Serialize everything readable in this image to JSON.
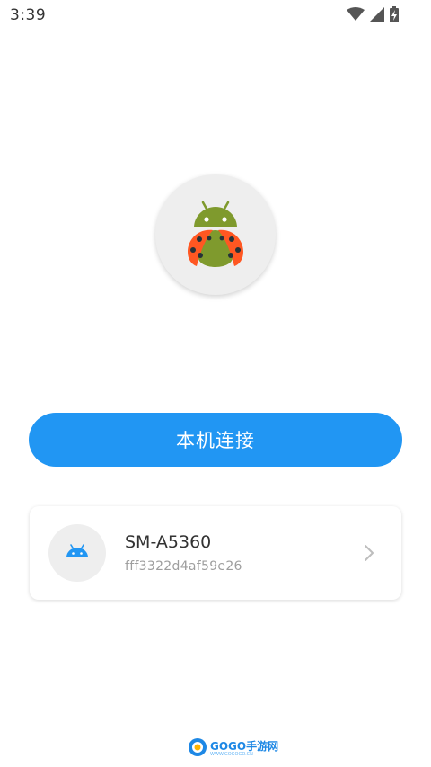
{
  "status_bar": {
    "time": "3:39",
    "icons": [
      "wifi-icon",
      "signal-icon",
      "battery-charging-icon"
    ]
  },
  "app": {
    "logo_icon": "ladybug-android-logo"
  },
  "actions": {
    "connect_local_label": "本机连接"
  },
  "devices": [
    {
      "name": "SM-A5360",
      "serial": "fff3322d4af59e26",
      "icon": "android-icon"
    }
  ],
  "watermark": {
    "brand": "GOGO手游网",
    "url": "WWW.GOGOGO.CN"
  },
  "colors": {
    "primary": "#2196f3",
    "android_green": "#7f9a2d",
    "ladybug_orange": "#ff5722"
  }
}
